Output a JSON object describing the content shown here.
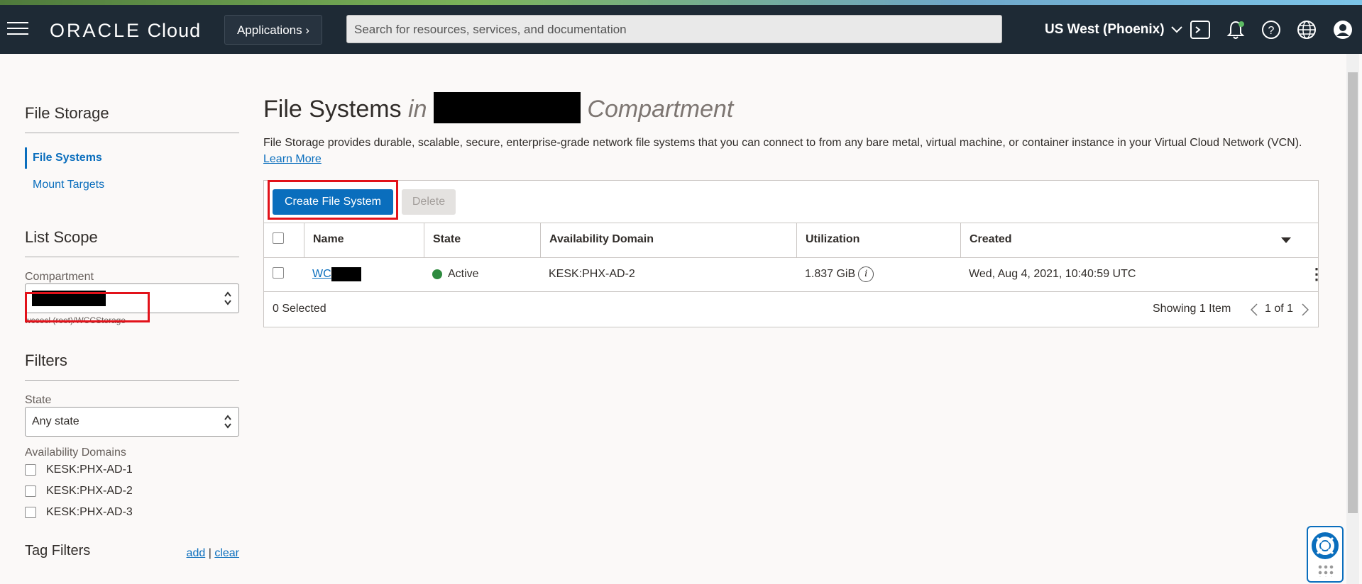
{
  "header": {
    "logo_brand": "ORACLE",
    "logo_product": "Cloud",
    "applications_label": "Applications",
    "search_placeholder": "Search for resources, services, and documentation",
    "region": "US West (Phoenix)"
  },
  "sidebar": {
    "section_title": "File Storage",
    "nav": [
      {
        "label": "File Systems",
        "active": true
      },
      {
        "label": "Mount Targets",
        "active": false
      }
    ],
    "list_scope_title": "List Scope",
    "compartment_label": "Compartment",
    "compartment_path": "wccocl (root)/WCCStorage",
    "filters_title": "Filters",
    "state_label": "State",
    "state_value": "Any state",
    "ad_label": "Availability Domains",
    "availability_domains": [
      "KESK:PHX-AD-1",
      "KESK:PHX-AD-2",
      "KESK:PHX-AD-3"
    ],
    "tag_filters_title": "Tag Filters",
    "tag_add": "add",
    "tag_sep": "|",
    "tag_clear": "clear"
  },
  "main": {
    "title": "File Systems",
    "title_in": "in",
    "title_compartment": "Compartment",
    "description": "File Storage provides durable, scalable, secure, enterprise-grade network file systems that you can connect to from any bare metal, virtual machine, or container instance in your Virtual Cloud Network (VCN).",
    "learn_more": "Learn More",
    "create_button": "Create File System",
    "delete_button": "Delete",
    "columns": [
      "Name",
      "State",
      "Availability Domain",
      "Utilization",
      "Created"
    ],
    "rows": [
      {
        "name": "WC",
        "state": "Active",
        "availability_domain": "KESK:PHX-AD-2",
        "utilization": "1.837 GiB",
        "created": "Wed, Aug 4, 2021, 10:40:59 UTC"
      }
    ],
    "selected_count": "0 Selected",
    "showing": "Showing 1 Item",
    "pagination": "1 of 1"
  },
  "colors": {
    "topbar": "#1e2a35",
    "accent": "#0a6ebd",
    "status_active": "#2d8a3e",
    "highlight": "#e2121a"
  },
  "icons": [
    "hamburger-icon",
    "chevron-right-icon",
    "chevron-down-icon",
    "cloud-shell-icon",
    "bell-icon",
    "help-icon",
    "globe-icon",
    "profile-icon",
    "info-icon",
    "kebab-icon",
    "sort-caret-icon",
    "lifebuoy-icon"
  ]
}
